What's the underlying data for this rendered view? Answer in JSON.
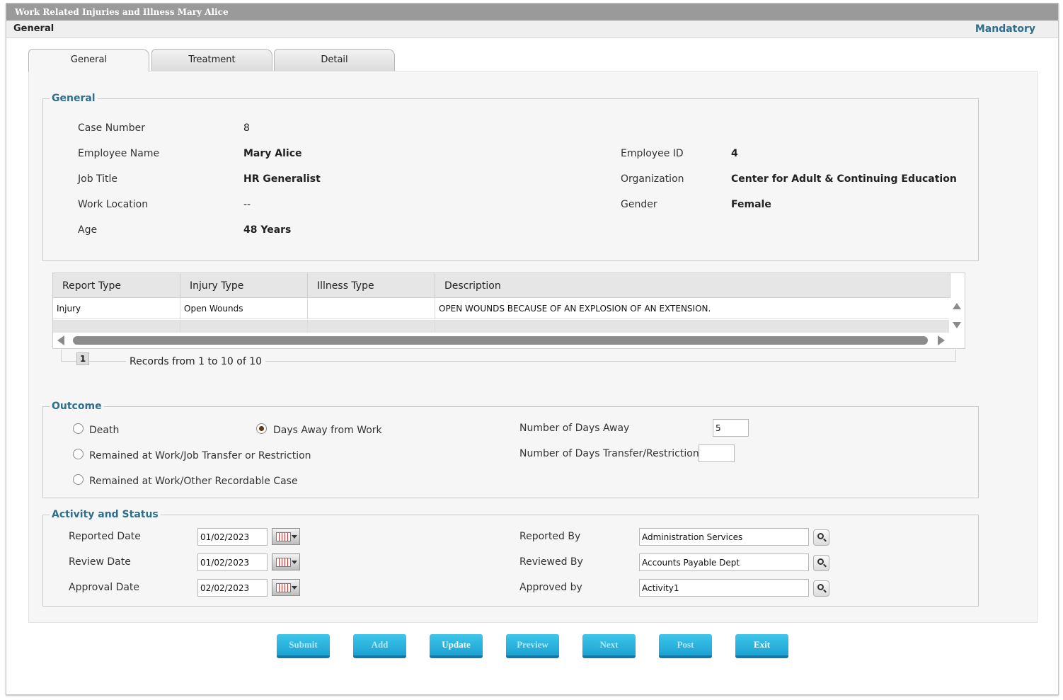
{
  "window": {
    "title": "Work Related Injuries and Illness  Mary Alice"
  },
  "subbar": {
    "left": "General",
    "right": "Mandatory"
  },
  "tabs": [
    {
      "label": "General"
    },
    {
      "label": "Treatment"
    },
    {
      "label": "Detail"
    }
  ],
  "general": {
    "legend": "General",
    "case_number_label": "Case Number",
    "case_number": "8",
    "employee_name_label": "Employee Name",
    "employee_name": "Mary Alice",
    "job_title_label": "Job Title",
    "job_title": "HR Generalist",
    "work_location_label": "Work Location",
    "work_location": "--",
    "age_label": "Age",
    "age": "48 Years",
    "employee_id_label": "Employee ID",
    "employee_id": "4",
    "organization_label": "Organization",
    "organization": "Center for Adult & Continuing Education",
    "gender_label": "Gender",
    "gender": "Female"
  },
  "grid": {
    "columns": [
      "Report Type",
      "Injury Type",
      "Illness Type",
      "Description"
    ],
    "rows": [
      [
        "Injury",
        "Open Wounds",
        "",
        "OPEN WOUNDS BECAUSE OF AN EXPLOSION OF AN EXTENSION."
      ]
    ],
    "page": "1",
    "records_text": "Records from 1 to 10 of 10"
  },
  "outcome": {
    "legend": "Outcome",
    "death": "Death",
    "days_away": "Days Away from Work",
    "job_transfer": "Remained at Work/Job Transfer or Restriction",
    "other_recordable": "Remained at Work/Other Recordable Case",
    "selected": "Days Away from Work",
    "days_away_count_label": "Number of Days Away",
    "days_away_count": "5",
    "days_transfer_label": "Number of Days Transfer/Restriction",
    "days_transfer": ""
  },
  "activity": {
    "legend": "Activity and Status",
    "reported_date_label": "Reported Date",
    "reported_date": "01/02/2023",
    "review_date_label": "Review Date",
    "review_date": "01/02/2023",
    "approval_date_label": "Approval Date",
    "approval_date": "02/02/2023",
    "reported_by_label": "Reported By",
    "reported_by": "Administration Services",
    "reviewed_by_label": "Reviewed By",
    "reviewed_by": "Accounts Payable Dept",
    "approved_by_label": "Approved by",
    "approved_by": "Activity1"
  },
  "buttons": {
    "submit": "Submit",
    "add": "Add",
    "update": "Update",
    "preview": "Preview",
    "next": "Next",
    "post": "Post",
    "exit": "Exit"
  },
  "colors": {
    "accent": "#2e6e8e",
    "button": "#1ba2d2",
    "titlebar": "#9a9a9a"
  }
}
